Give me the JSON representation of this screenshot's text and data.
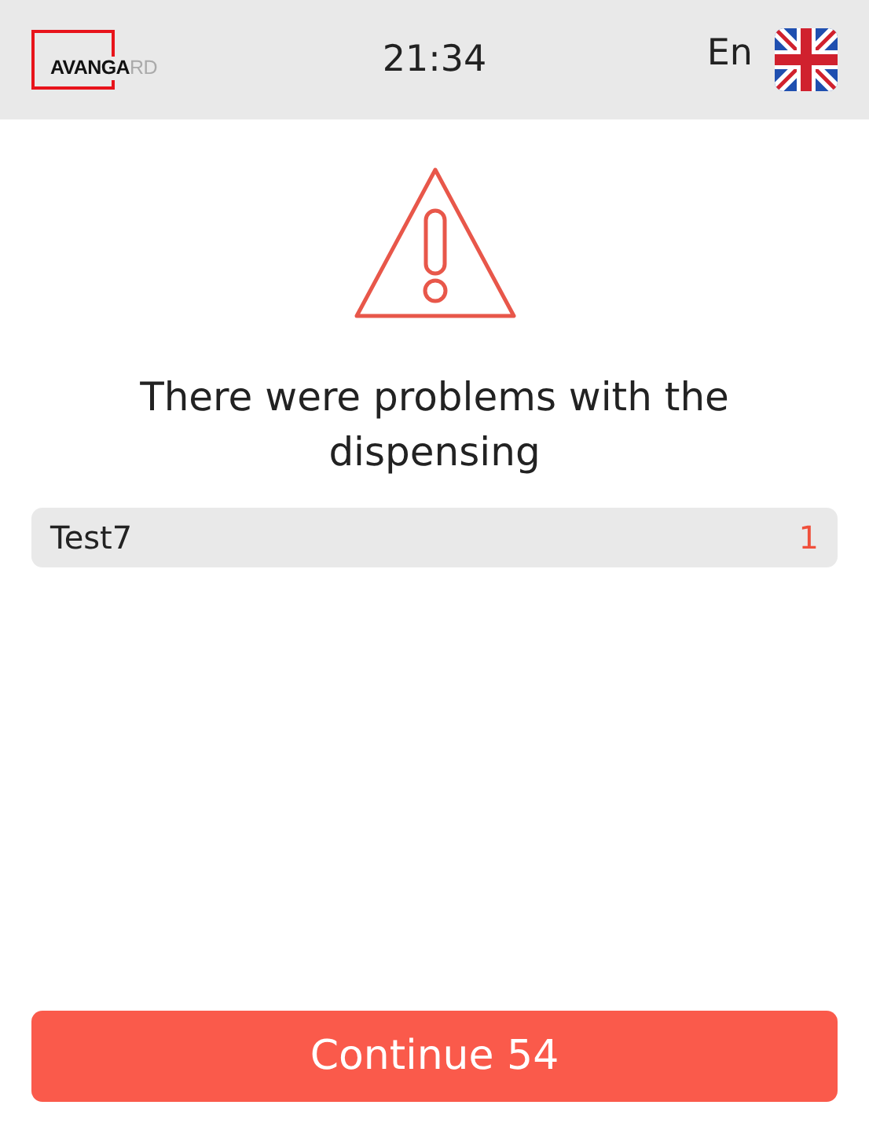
{
  "header": {
    "logo": {
      "dark_part": "AVANGA",
      "light_part": "RD"
    },
    "time": "21:34",
    "language": "En"
  },
  "message": "There were problems with the dispensing",
  "items": [
    {
      "name": "Test7",
      "count": "1"
    }
  ],
  "continue_button": "Continue 54"
}
